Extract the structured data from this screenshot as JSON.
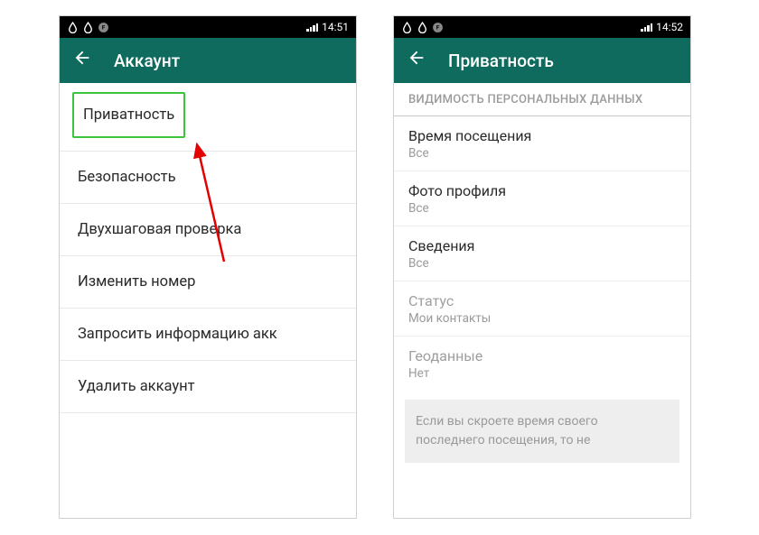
{
  "phone_left": {
    "status_time": "14:51",
    "app_title": "Аккаунт",
    "items": [
      "Приватность",
      "Безопасность",
      "Двухшаговая проверка",
      "Изменить номер",
      "Запросить информацию акк",
      "Удалить аккаунт"
    ]
  },
  "phone_right": {
    "status_time": "14:52",
    "app_title": "Приватность",
    "section_header": "ВИДИМОСТЬ ПЕРСОНАЛЬНЫХ ДАННЫХ",
    "settings": [
      {
        "title": "Время посещения",
        "value": "Все"
      },
      {
        "title": "Фото профиля",
        "value": "Все"
      },
      {
        "title": "Сведения",
        "value": "Все"
      },
      {
        "title": "Статус",
        "value": "Мои контакты"
      },
      {
        "title": "Геоданные",
        "value": "Нет"
      }
    ],
    "info_text": "Если вы скроете время своего последнего посещения, то не"
  }
}
